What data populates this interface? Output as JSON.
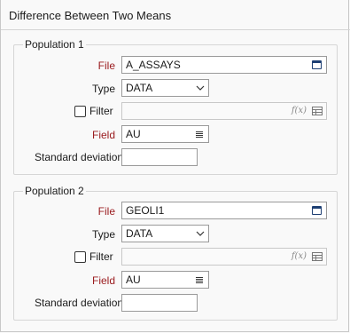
{
  "window": {
    "title": "Difference Between Two Means"
  },
  "groups": [
    {
      "title": "Population 1",
      "file_label": "File",
      "file_value": "A_ASSAYS",
      "type_label": "Type",
      "type_value": "DATA",
      "filter_label": "Filter",
      "filter_checked": false,
      "filter_value": "",
      "field_label": "Field",
      "field_value": "AU",
      "stddev_label": "Standard deviation",
      "stddev_value": ""
    },
    {
      "title": "Population 2",
      "file_label": "File",
      "file_value": "GEOLI1",
      "type_label": "Type",
      "type_value": "DATA",
      "filter_label": "Filter",
      "filter_checked": false,
      "filter_value": "",
      "field_label": "Field",
      "field_value": "AU",
      "stddev_label": "Standard deviation",
      "stddev_value": ""
    }
  ],
  "icons": {
    "file_browse": "calendar-table-icon",
    "type_dropdown": "chevron-down-icon",
    "filter_expression": "fx-icon",
    "filter_grid": "grid-icon",
    "field_list": "list-menu-icon",
    "fx_text": "f(x)"
  },
  "colors": {
    "required_label": "#9b1d20",
    "icon_blue": "#1e3f73",
    "border": "#9a9a9a"
  }
}
